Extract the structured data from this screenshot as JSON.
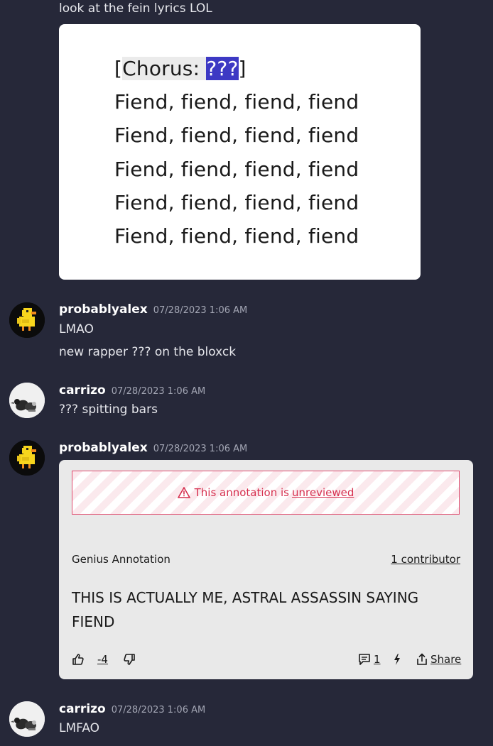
{
  "messages": {
    "m0": {
      "text": "look at the fein lyrics LOL"
    },
    "m1": {
      "username": "probablyalex",
      "timestamp": "07/28/2023 1:06 AM",
      "lines": [
        "LMAO",
        "new rapper ??? on the bloxck"
      ]
    },
    "m2": {
      "username": "carrizo",
      "timestamp": "07/28/2023 1:06 AM",
      "text": "??? spitting bars"
    },
    "m3": {
      "username": "probablyalex",
      "timestamp": "07/28/2023 1:06 AM"
    },
    "m4": {
      "username": "carrizo",
      "timestamp": "07/28/2023 1:06 AM",
      "text": "LMFAO"
    }
  },
  "lyrics": {
    "chorus_open": "[",
    "chorus_word": "Chorus: ",
    "chorus_name": "???",
    "chorus_close": "]",
    "lines": [
      "Fiend, fiend, fiend, fiend",
      "Fiend, fiend, fiend, fiend",
      "Fiend, fiend, fiend, fiend",
      "Fiend, fiend, fiend, fiend",
      "Fiend, fiend, fiend, fiend"
    ]
  },
  "annotation": {
    "warning_prefix": "This annotation is",
    "warning_link": "unreviewed",
    "label": "Genius Annotation",
    "contributors": "1 contributor",
    "body": "THIS IS ACTUALLY ME, ASTRAL ASSASSIN SAYING FIEND",
    "votes": "-4",
    "comments": "1",
    "share": "Share"
  },
  "colors": {
    "background": "#262839",
    "highlight_blue": "#3d39c4",
    "warning_red": "#d6304f"
  },
  "icons": [
    "duck-avatar",
    "bird-avatar",
    "warning-icon",
    "thumbs-up-icon",
    "thumbs-down-icon",
    "comment-icon",
    "lightning-icon",
    "share-icon"
  ]
}
